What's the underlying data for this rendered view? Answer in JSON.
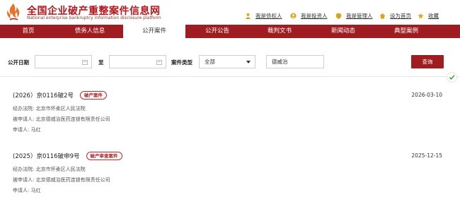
{
  "header": {
    "title": "全国企业破产重整案件信息网",
    "subtitle": "National enterprise bankruptcy information disclosure platform",
    "links": [
      {
        "label": "我是债权人",
        "icon": "user-icon"
      },
      {
        "label": "我是投资人",
        "icon": "person-circle-icon"
      },
      {
        "label": "我是管理人",
        "icon": "shield-icon"
      },
      {
        "label": "设为首页",
        "icon": "home-icon"
      },
      {
        "label": "收藏",
        "icon": "star-icon"
      }
    ]
  },
  "nav": {
    "items": [
      {
        "label": "首页"
      },
      {
        "label": "债务人信息"
      },
      {
        "label": "公开案件"
      },
      {
        "label": "公开公告"
      },
      {
        "label": "裁判文书"
      },
      {
        "label": "新闻动态"
      },
      {
        "label": "典型案例"
      }
    ],
    "active_index": 2
  },
  "filter": {
    "date_label": "公开日期",
    "to_label": "至",
    "start_date_value": "",
    "end_date_value": "",
    "type_label": "案件类型",
    "type_selected": "全部",
    "keyword_value": "德威治",
    "search_button": "查询"
  },
  "cases": [
    {
      "case_no": "(2026）京0116破2号",
      "tag": "破产案件",
      "date": "2026-03-10",
      "court": "经办法院: 北京市怀柔区人民法院",
      "respondent": "被申请人: 北京德威治医药连锁有限责任公司",
      "applicant": "申请人: 马红"
    },
    {
      "case_no": "(2025）京0116破申9号",
      "tag": "破产审查案件",
      "date": "2025-12-15",
      "court": "经办法院: 北京市怀柔区人民法院",
      "respondent": "被申请人: 北京德威治医药连锁有限责任公司",
      "applicant": "申请人: 马红"
    }
  ],
  "colors": {
    "brand_red": "#9f1d20",
    "tag_red": "#c1272d",
    "logo_orange": "#e8732a",
    "icon_gold": "#d9a521"
  }
}
